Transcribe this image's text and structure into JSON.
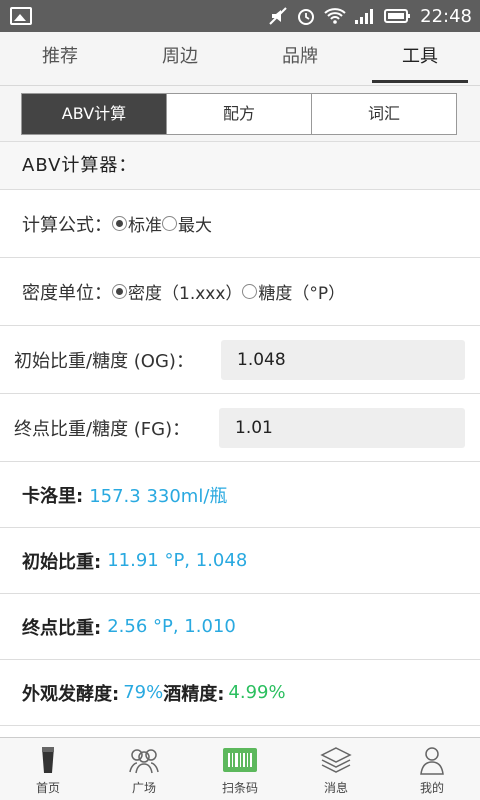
{
  "status": {
    "time": "22:48"
  },
  "top_tabs": [
    {
      "label": "推荐"
    },
    {
      "label": "周边"
    },
    {
      "label": "品牌"
    },
    {
      "label": "工具"
    }
  ],
  "segments": [
    {
      "label": "ABV计算"
    },
    {
      "label": "配方"
    },
    {
      "label": "词汇"
    }
  ],
  "section_title": "ABV计算器：",
  "formula": {
    "label": "计算公式：",
    "options": [
      "标准",
      "最大"
    ],
    "selected": "标准"
  },
  "unit": {
    "label": "密度单位：",
    "options": [
      "密度（1.xxx）",
      "糖度（°P）"
    ],
    "selected": "密度（1.xxx）"
  },
  "og": {
    "label": "初始比重/糖度 (OG)：",
    "value": "1.048"
  },
  "fg": {
    "label": "终点比重/糖度 (FG)：",
    "value": "1.01"
  },
  "results": {
    "calories_label": "卡洛里:",
    "calories_value": "157.3 330ml/瓶",
    "og_label": "初始比重:",
    "og_value": "11.91 °P, 1.048",
    "fg_label": "终点比重:",
    "fg_value": "2.56 °P, 1.010",
    "attenuation_label": "外观发酵度:",
    "attenuation_value": "79%",
    "abv_label": "酒精度:",
    "abv_value": "4.99%"
  },
  "bottom_nav": [
    {
      "label": "首页",
      "icon": "beer-glass-icon"
    },
    {
      "label": "广场",
      "icon": "people-icon"
    },
    {
      "label": "扫条码",
      "icon": "barcode-icon"
    },
    {
      "label": "消息",
      "icon": "layers-icon"
    },
    {
      "label": "我的",
      "icon": "person-icon"
    }
  ],
  "colors": {
    "accent_blue": "#29a9e0",
    "accent_green": "#2bbf5f",
    "barcode_green": "#5cb85c"
  }
}
